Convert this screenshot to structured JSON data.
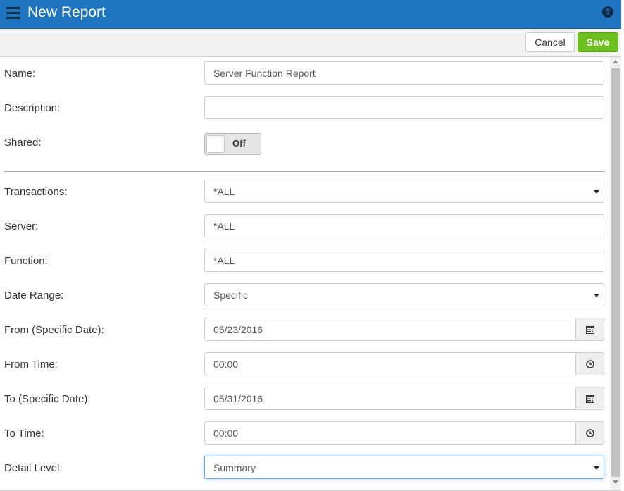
{
  "header": {
    "title": "New Report",
    "help_icon": "question-circle-icon"
  },
  "toolbar": {
    "cancel_label": "Cancel",
    "save_label": "Save"
  },
  "colors": {
    "header_bg": "#1f74c0",
    "save_bg": "#6cbf1f"
  },
  "form": {
    "name": {
      "label": "Name:",
      "value": "Server Function Report"
    },
    "description": {
      "label": "Description:",
      "value": ""
    },
    "shared": {
      "label": "Shared:",
      "state": "Off"
    },
    "transactions": {
      "label": "Transactions:",
      "value": "*ALL"
    },
    "server": {
      "label": "Server:",
      "value": "*ALL"
    },
    "function": {
      "label": "Function:",
      "value": "*ALL"
    },
    "date_range": {
      "label": "Date Range:",
      "value": "Specific"
    },
    "from_date": {
      "label": "From (Specific Date):",
      "value": "05/23/2016",
      "icon": "calendar-icon"
    },
    "from_time": {
      "label": "From Time:",
      "value": "00:00",
      "icon": "clock-icon"
    },
    "to_date": {
      "label": "To (Specific Date):",
      "value": "05/31/2016",
      "icon": "calendar-icon"
    },
    "to_time": {
      "label": "To Time:",
      "value": "00:00",
      "icon": "clock-icon"
    },
    "detail_level": {
      "label": "Detail Level:",
      "value": "Summary"
    }
  }
}
